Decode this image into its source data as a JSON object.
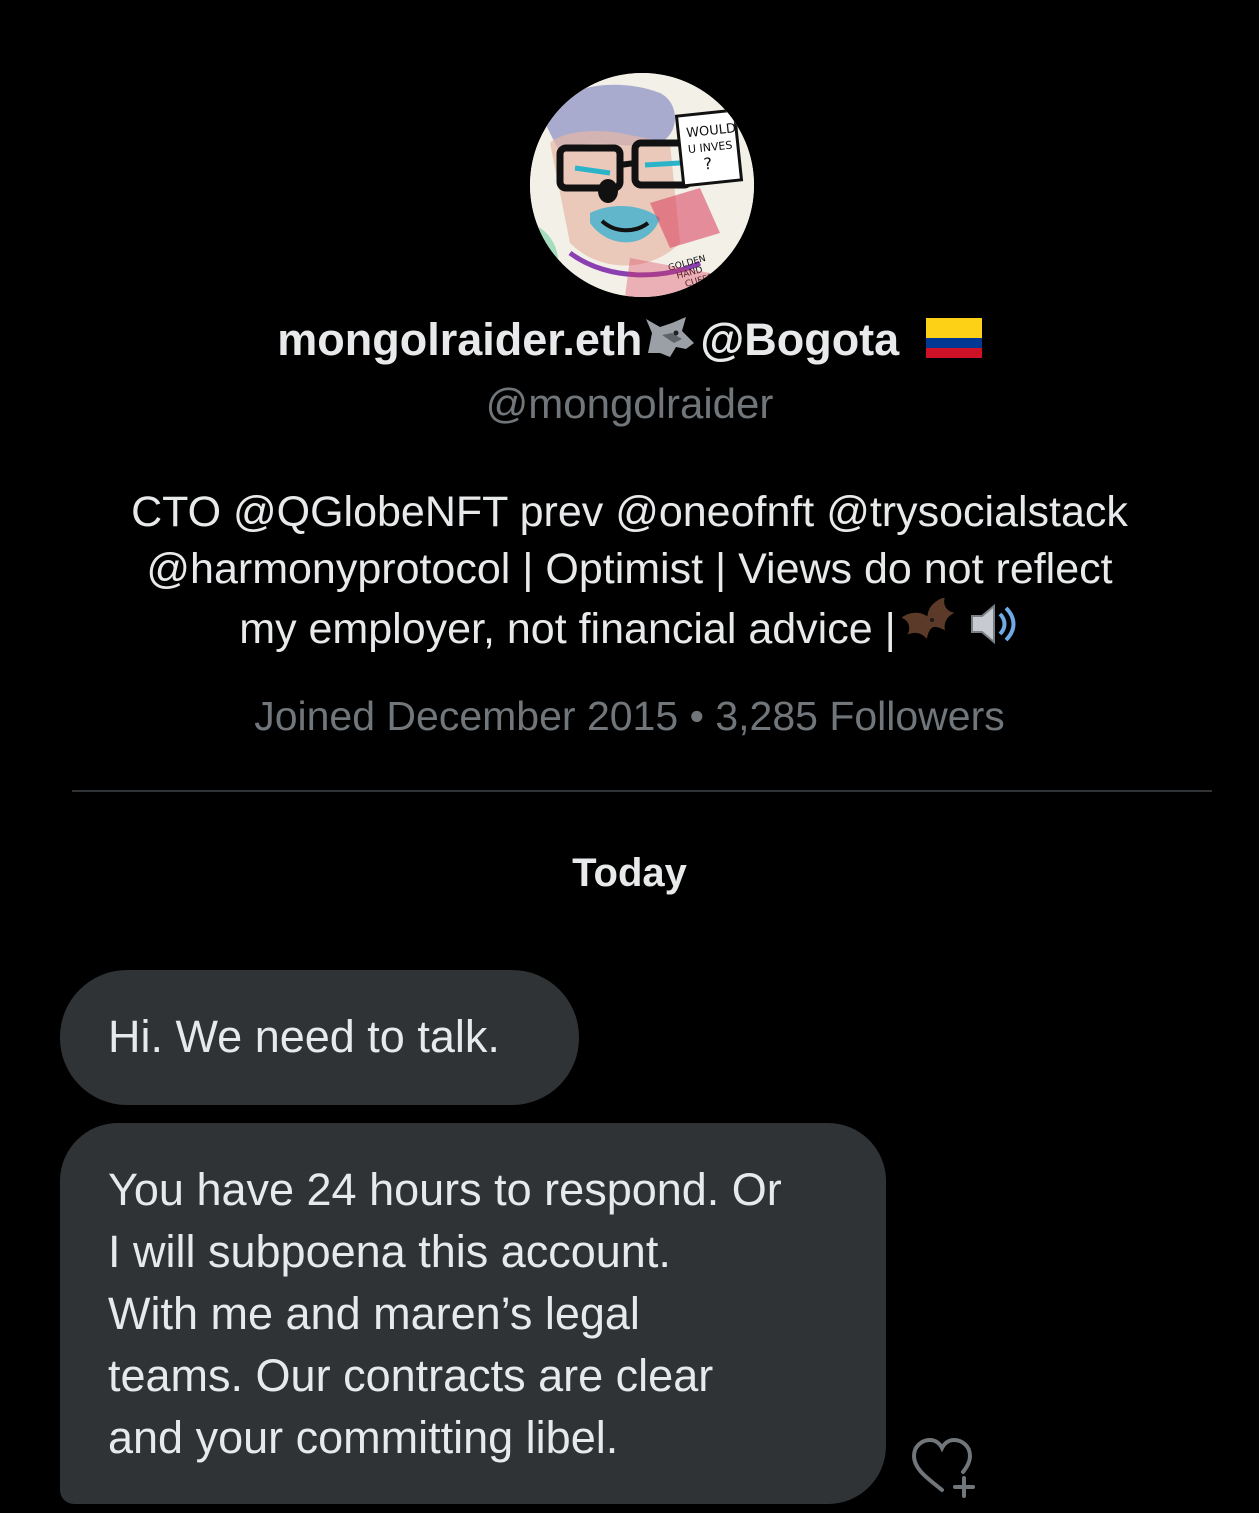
{
  "profile": {
    "display_name_part1": "mongolraider.eth",
    "display_name_part2": "@Bogota",
    "name_emojis": [
      "wolf-icon",
      "colombia-flag-icon"
    ],
    "handle": "@mongolraider",
    "bio_lines": [
      "CTO @QGlobeNFT prev @oneofnft @trysocialstack",
      "@harmonyprotocol | Optimist | Views do not reflect",
      "my employer, not financial advice |"
    ],
    "bio_emojis": [
      "bat-icon",
      "speaker-icon"
    ],
    "joined": "Joined December 2015",
    "separator": "•",
    "followers": "3,285 Followers"
  },
  "conversation": {
    "day_label": "Today",
    "messages": [
      {
        "lines": [
          "Hi. We need to talk."
        ]
      },
      {
        "lines": [
          "You have 24 hours to respond. Or",
          "I will subpoena this account.",
          "With me and maren’s legal",
          "teams. Our contracts are clear",
          "and your committing libel."
        ]
      }
    ],
    "reaction_icon": "heart-plus-icon"
  },
  "colors": {
    "background": "#000000",
    "primary_text": "#e7e9ea",
    "secondary_text": "#71767b",
    "bubble": "#2f3336",
    "divider": "#2f3336"
  }
}
